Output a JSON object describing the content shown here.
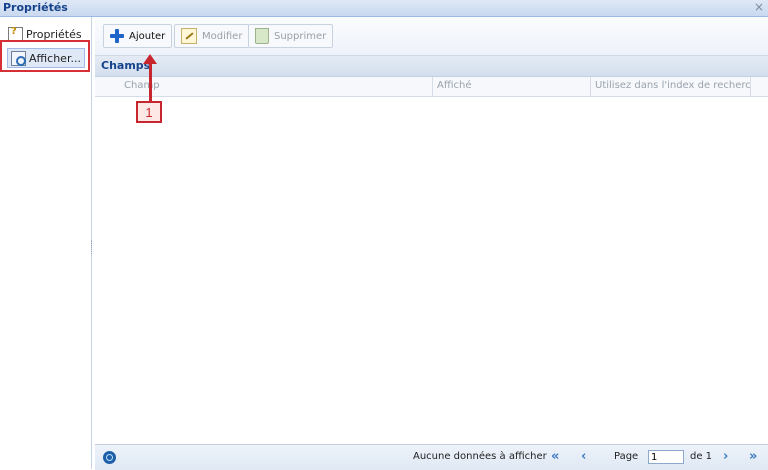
{
  "window": {
    "title": "Propriétés",
    "close_icon": "×"
  },
  "sidebar": {
    "items": [
      {
        "label": "Propriétés",
        "icon": "properties-icon"
      },
      {
        "label": "Afficher...",
        "icon": "view-icon",
        "selected": true
      }
    ]
  },
  "toolbar": {
    "add_label": "Ajouter",
    "edit_label": "Modifier",
    "delete_label": "Supprimer"
  },
  "grid": {
    "title": "Champs",
    "columns": [
      "Champ",
      "Affiché",
      "Utilisez dans l'index de recherch"
    ],
    "rows": []
  },
  "annotation": {
    "number": "1"
  },
  "pager": {
    "empty_message": "Aucune données à afficher",
    "page_label": "Page",
    "page_value": "1",
    "of_label": "de 1"
  },
  "colors": {
    "accent": "#15428b",
    "callout": "#c8262e"
  }
}
